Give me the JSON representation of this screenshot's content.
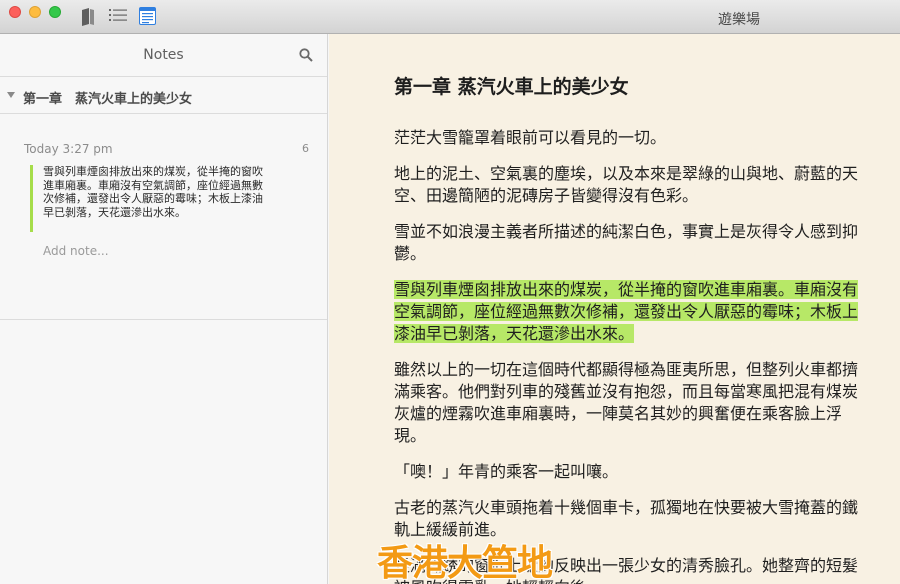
{
  "window": {
    "title": "遊樂場"
  },
  "sidebar": {
    "title": "Notes",
    "chapter": "第一章　蒸汽火車上的美少女",
    "note": {
      "time": "Today 3:27 pm",
      "count": "6",
      "quote": "雪與列車煙囪排放出來的煤炭，從半掩的窗吹進車廂裏。車廂沒有空氣調節，座位經過無數次修補，還發出令人厭惡的霉味；木板上漆油早已剝落，天花還滲出水來。",
      "add_placeholder": "Add note..."
    }
  },
  "reader": {
    "chapter_title": "第一章 蒸汽火車上的美少女",
    "paragraphs": [
      "茫茫大雪籠罩着眼前可以看見的一切。",
      "地上的泥土、空氣裏的塵埃，以及本來是翠綠的山與地、蔚藍的天空、田邊簡陋的泥磚房子皆變得沒有色彩。",
      "雪並不如浪漫主義者所描述的純潔白色，事實上是灰得令人感到抑鬱。",
      "雪與列車煙囪排放出來的煤炭，從半掩的窗吹進車廂裏。車廂沒有空氣調節，座位經過無數次修補，還發出令人厭惡的霉味；木板上漆油早已剝落，天花還滲出水來。",
      "雖然以上的一切在這個時代都顯得極為匪夷所思，但整列火車都擠滿乘客。他們對列車的殘舊並沒有抱怨，而且每當寒風把混有煤炭灰爐的煙霧吹進車廂裏時，一陣莫名其妙的興奮便在乘客臉上浮現。",
      "「噢！」年青的乘客一起叫嚷。",
      "古老的蒸汽火車頭拖着十幾個車卡，孤獨地在快要被大雪掩蓋的鐵軌上緩緩前進。",
      "長滿鐵銹的窗框上隱約反映出一張少女的清秀臉孔。她整齊的短髮被風吹得零亂，她輕輕向後一"
    ]
  },
  "watermark": "香港大笪地"
}
